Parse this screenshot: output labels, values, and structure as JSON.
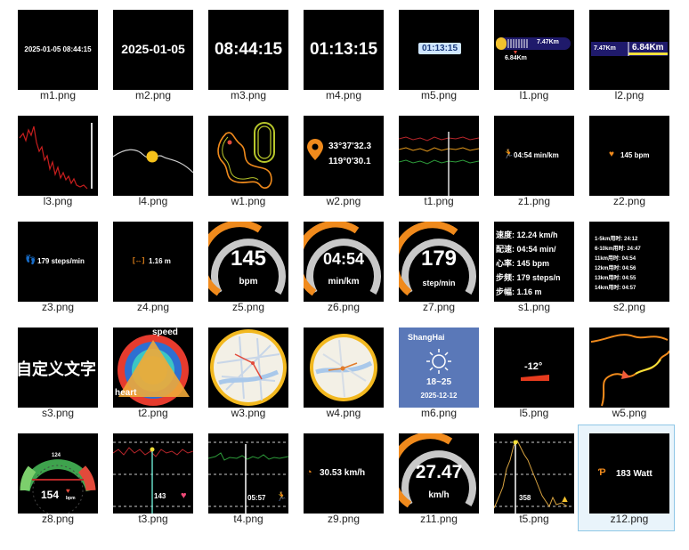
{
  "files": [
    {
      "label": "m1.png"
    },
    {
      "label": "m2.png"
    },
    {
      "label": "m3.png"
    },
    {
      "label": "m4.png"
    },
    {
      "label": "m5.png"
    },
    {
      "label": "l1.png"
    },
    {
      "label": "l2.png"
    },
    {
      "label": "l3.png"
    },
    {
      "label": "l4.png"
    },
    {
      "label": "w1.png"
    },
    {
      "label": "w2.png"
    },
    {
      "label": "t1.png"
    },
    {
      "label": "z1.png"
    },
    {
      "label": "z2.png"
    },
    {
      "label": "z3.png"
    },
    {
      "label": "z4.png"
    },
    {
      "label": "z5.png"
    },
    {
      "label": "z6.png"
    },
    {
      "label": "z7.png"
    },
    {
      "label": "s1.png"
    },
    {
      "label": "s2.png"
    },
    {
      "label": "s3.png"
    },
    {
      "label": "t2.png"
    },
    {
      "label": "w3.png"
    },
    {
      "label": "w4.png"
    },
    {
      "label": "m6.png"
    },
    {
      "label": "l5.png"
    },
    {
      "label": "w5.png"
    },
    {
      "label": "z8.png"
    },
    {
      "label": "t3.png"
    },
    {
      "label": "t4.png"
    },
    {
      "label": "z9.png"
    },
    {
      "label": "z11.png"
    },
    {
      "label": "t5.png"
    },
    {
      "label": "z12.png"
    }
  ],
  "previews": {
    "m1": "2025-01-05 08:44:15",
    "m2": "2025-01-05",
    "m3": "08:44:15",
    "m4": "01:13:15",
    "m5": "01:13:15",
    "l1_value": "7.47Km",
    "l1_marker": "6.84Km",
    "l2_left": "7.47Km",
    "l2_right": "6.84Km",
    "w2_lat": "33°37'32.3",
    "w2_lon": "119°0'30.1",
    "z1": "04:54 min/km",
    "z2": "145 bpm",
    "z3": "179 steps/min",
    "z4": "1.16 m",
    "z5_value": "145",
    "z5_unit": "bpm",
    "z6_value": "04:54",
    "z6_unit": "min/km",
    "z7_value": "179",
    "z7_unit": "step/min",
    "s1_lines": [
      "速度: 12.24 km/h",
      "配速: 04:54 min/",
      "心率: 145 bpm",
      "步频: 179 steps/n",
      "步幅: 1.16 m"
    ],
    "s2_lines": [
      "1-5km用时: 24:12",
      "6-10km用时: 24:47",
      "11km用时: 04:54",
      "12km用时: 04:56",
      "13km用时: 04:55",
      "14km用时: 04:57"
    ],
    "s3": "自定义文字",
    "t2_top": "speed",
    "t2_left": "heart",
    "m6_city": "ShangHai",
    "m6_temp": "18~25",
    "m6_date": "2025-12-12",
    "l5": "-12°",
    "z8_value": "154",
    "z8_unit": "bpm",
    "z8_top": "124",
    "t3_value": "143",
    "t4_value": "05:57",
    "z9": "30.53 km/h",
    "z11_value": "27.47",
    "z11_unit": "km/h",
    "t5_value": "358",
    "z12": "183 Watt"
  },
  "colors": {
    "accent": "#f08a1c",
    "gray": "#c8c8c8",
    "blue": "#1a57d6",
    "selected": "#e9f4fb"
  }
}
